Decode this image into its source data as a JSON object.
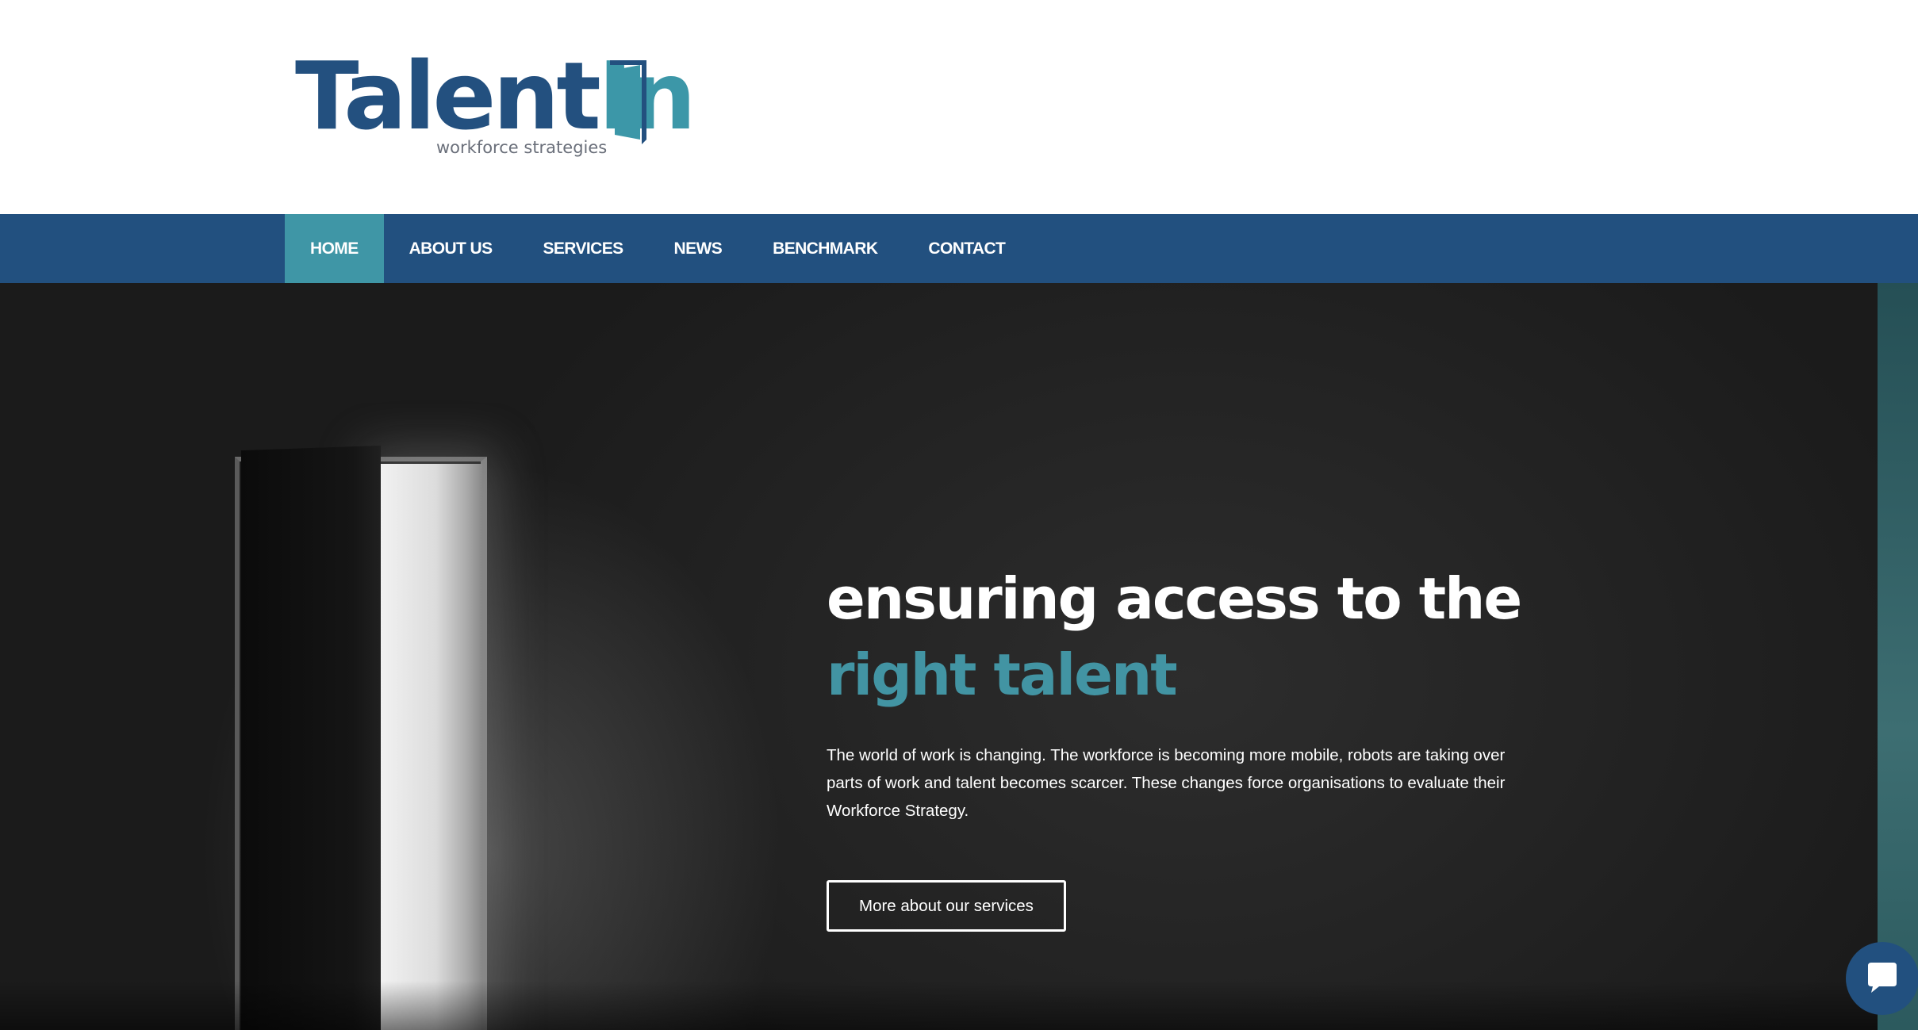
{
  "logo": {
    "word_main": "Talent",
    "word_accent": "In",
    "tagline": "workforce strategies"
  },
  "nav": {
    "items": [
      {
        "label": "HOME",
        "active": true
      },
      {
        "label": "ABOUT US",
        "active": false
      },
      {
        "label": "SERVICES",
        "active": false
      },
      {
        "label": "NEWS",
        "active": false
      },
      {
        "label": "BENCHMARK",
        "active": false
      },
      {
        "label": "CONTACT",
        "active": false
      }
    ]
  },
  "hero": {
    "title_line1": "ensuring access to the",
    "title_line2": "right talent",
    "text": "The world of work is changing. The workforce is becoming more mobile, robots are taking over parts of work and talent becomes scarcer. These changes force organisations to evaluate their Workforce Strategy.",
    "button_label": "More about our services"
  },
  "chat": {
    "icon": "chat-bubble-icon"
  },
  "colors": {
    "brand_blue": "#22507f",
    "accent_teal": "#4294a3",
    "hero_bg": "#1a1a1a"
  }
}
